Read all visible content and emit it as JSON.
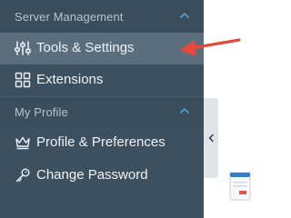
{
  "sidebar": {
    "sections": [
      {
        "title": "Server Management",
        "items": [
          {
            "label": "Tools & Settings",
            "icon": "sliders-icon",
            "active": true
          },
          {
            "label": "Extensions",
            "icon": "extensions-icon",
            "active": false
          }
        ]
      },
      {
        "title": "My Profile",
        "items": [
          {
            "label": "Profile & Preferences",
            "icon": "crown-icon",
            "active": false
          },
          {
            "label": "Change Password",
            "icon": "key-icon",
            "active": false
          }
        ]
      }
    ]
  },
  "colors": {
    "sidebar_bg": "#3d5060",
    "active_item_bg": "#5a6e7e",
    "chevron_accent": "#4aa8d8",
    "annotation_arrow": "#e8473a"
  },
  "collapse_tab": {
    "icon": "chevron-left-icon"
  },
  "file_thumbnail": {
    "icon": "document-icon"
  },
  "annotation": {
    "icon": "red-arrow-icon"
  }
}
